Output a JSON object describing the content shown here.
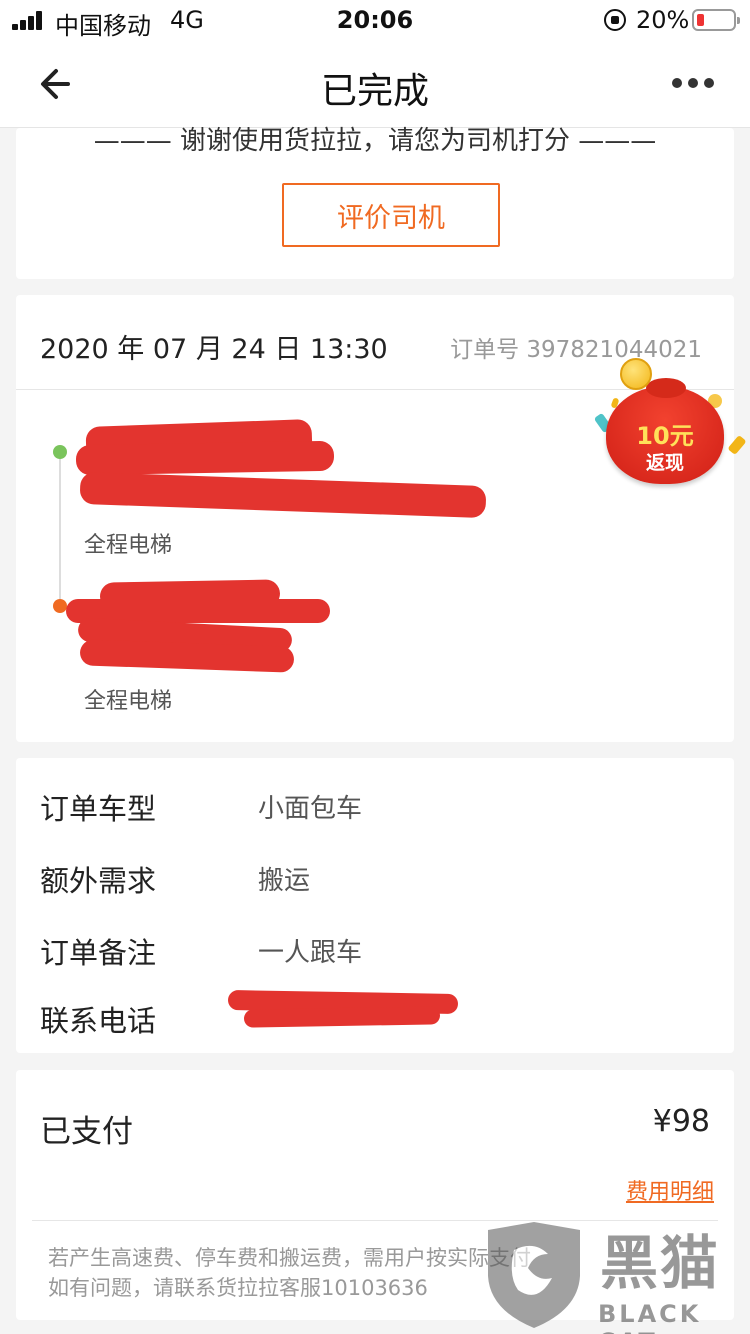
{
  "status_bar": {
    "carrier": "中国移动",
    "network": "4G",
    "time": "20:06",
    "battery": "20%",
    "battery_level": 0.2
  },
  "nav": {
    "title": "已完成",
    "back_icon": "arrow-left-icon",
    "more_icon": "more-dots-icon"
  },
  "rating": {
    "prompt": "——— 谢谢使用货拉拉，请您为司机打分 ———",
    "button": "评价司机"
  },
  "order": {
    "time": "2020 年 07 月 24 日 13:30",
    "number": "订单号 397821044021",
    "stops": [
      {
        "marker_color": "#7ac45c",
        "note": "全程电梯"
      },
      {
        "marker_color": "#f06a22",
        "note": "全程电梯"
      }
    ]
  },
  "promo": {
    "amount": "10元",
    "label": "返现"
  },
  "details": [
    {
      "key": "订单车型",
      "value": "小面包车"
    },
    {
      "key": "额外需求",
      "value": "搬运"
    },
    {
      "key": "订单备注",
      "value": "一人跟车"
    },
    {
      "key": "联系电话",
      "value": ""
    }
  ],
  "payment": {
    "status": "已支付",
    "amount": "¥98",
    "detail_link": "费用明细",
    "notes": [
      "若产生高速费、停车费和搬运费，需用户按实际支付",
      "如有问题，请联系货拉拉客服10103636"
    ]
  },
  "watermark": {
    "cn": "黑猫",
    "en": "BLACK CAT"
  },
  "colors": {
    "accent": "#f06a22",
    "start": "#7ac45c",
    "redaction": "#e3342f"
  }
}
